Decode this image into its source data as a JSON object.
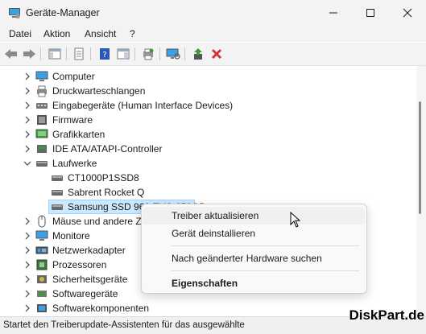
{
  "window": {
    "title": "Geräte-Manager"
  },
  "menu": [
    "Datei",
    "Aktion",
    "Ansicht",
    "?"
  ],
  "tree": {
    "items": [
      {
        "label": "Computer",
        "icon": "computer-icon",
        "level": 1,
        "expanded": false
      },
      {
        "label": "Druckwarteschlangen",
        "icon": "printer-icon",
        "level": 1,
        "expanded": false
      },
      {
        "label": "Eingabegeräte (Human Interface Devices)",
        "icon": "hid-icon",
        "level": 1,
        "expanded": false
      },
      {
        "label": "Firmware",
        "icon": "firmware-icon",
        "level": 1,
        "expanded": false
      },
      {
        "label": "Grafikkarten",
        "icon": "display-adapter-icon",
        "level": 1,
        "expanded": false
      },
      {
        "label": "IDE ATA/ATAPI-Controller",
        "icon": "ide-controller-icon",
        "level": 1,
        "expanded": false
      },
      {
        "label": "Laufwerke",
        "icon": "disk-drive-icon",
        "level": 1,
        "expanded": true
      },
      {
        "label": "CT1000P1SSD8",
        "icon": "disk-drive-icon",
        "level": 2
      },
      {
        "label": "Sabrent Rocket Q",
        "icon": "disk-drive-icon",
        "level": 2
      },
      {
        "label": "Samsung SSD 960 EVO 250GB",
        "icon": "disk-drive-icon",
        "level": 2,
        "selected": true
      },
      {
        "label": "Mäuse und andere Zeigegeräte",
        "icon": "mouse-icon",
        "level": 1,
        "expanded": false
      },
      {
        "label": "Monitore",
        "icon": "monitor-icon",
        "level": 1,
        "expanded": false
      },
      {
        "label": "Netzwerkadapter",
        "icon": "network-adapter-icon",
        "level": 1,
        "expanded": false
      },
      {
        "label": "Prozessoren",
        "icon": "processor-icon",
        "level": 1,
        "expanded": false
      },
      {
        "label": "Sicherheitsgeräte",
        "icon": "security-device-icon",
        "level": 1,
        "expanded": false
      },
      {
        "label": "Softwaregeräte",
        "icon": "software-device-icon",
        "level": 1,
        "expanded": false
      },
      {
        "label": "Softwarekomponenten",
        "icon": "software-component-icon",
        "level": 1,
        "expanded": false
      }
    ]
  },
  "context_menu": {
    "items": [
      {
        "label": "Treiber aktualisieren",
        "hovered": true
      },
      {
        "label": "Gerät deinstallieren"
      },
      {
        "label": "Nach geänderter Hardware suchen"
      },
      {
        "label": "Eigenschaften",
        "bold": true
      }
    ]
  },
  "status_bar": {
    "text": "Startet den Treiberupdate-Assistenten für das ausgewählte"
  },
  "watermark": "DiskPart.de",
  "colors": {
    "selection": "#cce8ff",
    "accent_green": "#3a9a3a",
    "accent_red": "#d13438"
  }
}
